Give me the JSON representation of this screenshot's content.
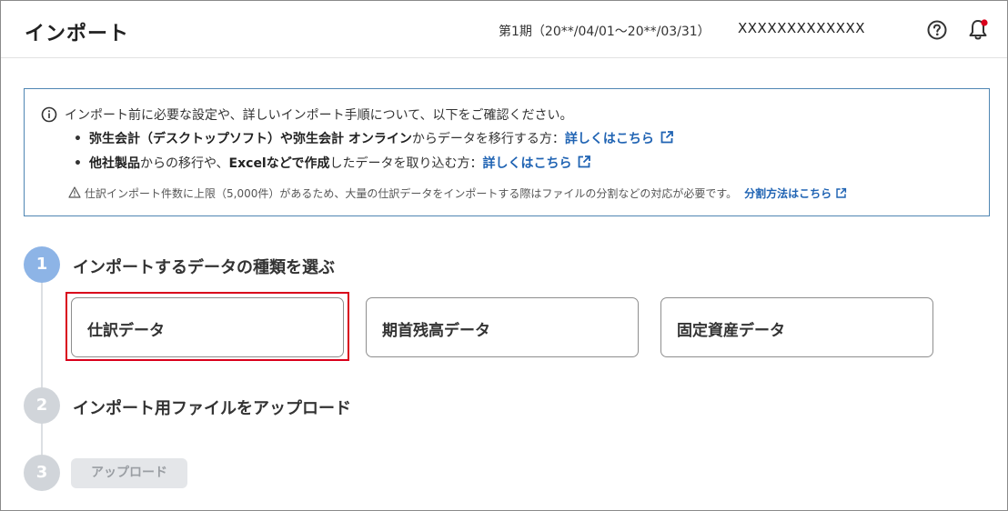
{
  "header": {
    "title": "インポート",
    "period": "第1期（20**/04/01〜20**/03/31）",
    "company": "XXXXXXXXXXXXX",
    "help_icon": "help-circle-icon",
    "bell_icon": "bell-icon",
    "notification_dot_color": "#d9001b"
  },
  "info": {
    "intro": "インポート前に必要な設定や、詳しいインポート手順について、以下をご確認ください。",
    "bullet1": {
      "bold1": "弥生会計（デスクトップソフト）や弥生会計 オンライン",
      "text": "からデータを移行する方：",
      "link": "詳しくはこちら"
    },
    "bullet2": {
      "bold1": "他社製品",
      "text1": "からの移行や、",
      "bold2": "Excelなどで作成",
      "text2": "したデータを取り込む方：",
      "link": "詳しくはこちら"
    },
    "warning": {
      "text": "仕訳インポート件数に上限（5,000件）があるため、大量の仕訳データをインポートする際はファイルの分割などの対応が必要です。",
      "link": "分割方法はこちら"
    },
    "border_color": "#4f86b3",
    "link_color": "#1f63b3"
  },
  "steps": [
    {
      "number": "1",
      "label": "インポートするデータの種類を選ぶ",
      "color": "#8db4e6"
    },
    {
      "number": "2",
      "label": "インポート用ファイルをアップロード",
      "color": "#d1d5da"
    },
    {
      "number": "3",
      "label": "",
      "color": "#d1d5da"
    }
  ],
  "data_types": [
    "仕訳データ",
    "期首残高データ",
    "固定資産データ"
  ],
  "upload_button": "アップロード",
  "highlight_color": "#d9001b"
}
